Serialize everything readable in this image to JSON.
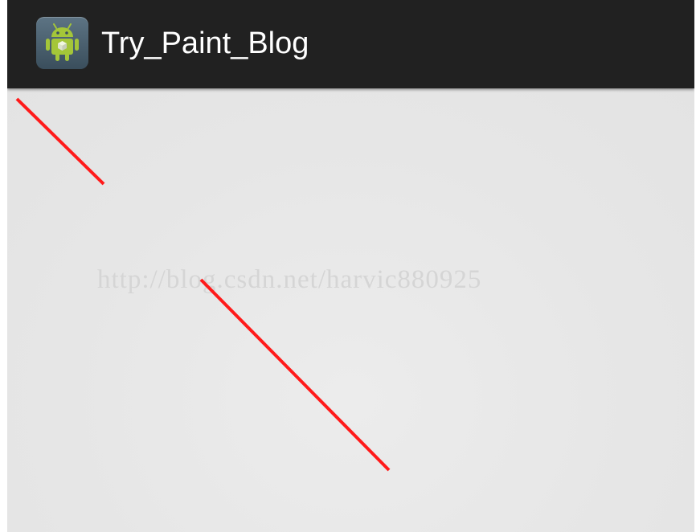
{
  "action_bar": {
    "title": "Try_Paint_Blog",
    "icon": "android-robot-icon",
    "background_color": "#212121"
  },
  "canvas": {
    "watermark": "http://blog.csdn.net/harvic880925",
    "background_color": "#e7e7e7",
    "line_color": "#ff1a1a",
    "line_count": 2
  }
}
